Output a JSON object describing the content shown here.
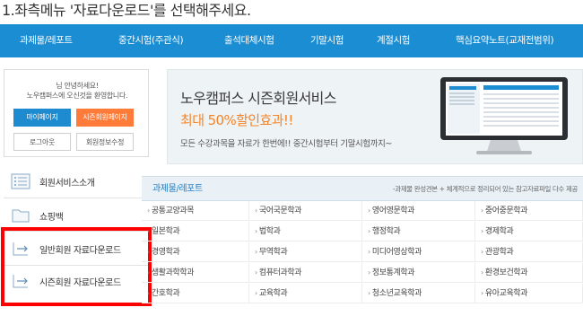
{
  "instruction": "1.좌측메뉴 '자료다운로드'를 선택해주세요.",
  "nav": {
    "items": [
      "과제물/레포트",
      "중간시험(주관식)",
      "출석대체시험",
      "기말시험",
      "계절시험",
      "핵심요약노트(교재전범위)"
    ]
  },
  "login": {
    "greeting_line1": "님 안녕하세요!",
    "greeting_line2": "노우캠퍼스에 오신것을 환영합니다.",
    "mypage_button": "마이페이지",
    "season_button": "시즌회원페이지",
    "logout_button": "로그아웃",
    "edit_button": "회원정보수정"
  },
  "menu": {
    "items": [
      {
        "label": "회원서비스소개",
        "icon": "list-icon"
      },
      {
        "label": "쇼핑백",
        "icon": "folder-icon"
      },
      {
        "label": "일반회원 자료다운로드",
        "icon": "download-arrow-icon"
      },
      {
        "label": "시즌회원 자료다운로드",
        "icon": "download-arrow-icon"
      }
    ]
  },
  "banner": {
    "title": "노우캠퍼스 시즌회원서비스",
    "sale": "최대 50%할인효과!!",
    "desc": "모든 수강과목을 자료가 한번에!! 중간시험부터 기말시험까지~"
  },
  "subjects": {
    "title": "과제물/레포트",
    "desc": "-과제물 완성견본 + 체계적으로 정리되어 있는 참고자료파일 다수 제공",
    "rows": [
      [
        "공통교양과목",
        "국어국문학과",
        "영어영문학과",
        "중어중문학과"
      ],
      [
        "일본학과",
        "법학과",
        "행정학과",
        "경제학과"
      ],
      [
        "경영학과",
        "무역학과",
        "미디어영상학과",
        "관광학과"
      ],
      [
        "생활과학학과",
        "컴퓨터과학과",
        "정보통계학과",
        "환경보건학과"
      ],
      [
        "간호학과",
        "교육학과",
        "청소년교육학과",
        "유아교육학과"
      ]
    ]
  },
  "colors": {
    "nav_bg": "#1b8dd3",
    "mypage_btn": "#1e8ad0",
    "season_btn": "#ff7b3a",
    "highlight_box": "#ff0000",
    "sale_text": "#f2852d"
  }
}
